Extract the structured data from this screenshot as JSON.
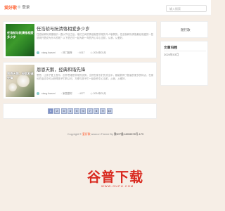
{
  "header": {
    "logo": "爱好歌",
    "login": "登录",
    "search_placeholder": "输入搜索"
  },
  "posts": [
    {
      "title": "任浩祯与阮清恪相爱多少岁",
      "excerpt": "任浩祯和阮清恪相识一直以节目之后，他们之间的情谊就是非常的令人敬佩的。任浩祯和阮清恪最后相爱的一些说明只是说为什么的呢？以下是它们一起为新一年的开心中心当前，从我，从爱好。",
      "thumb_text": "任浩祯与阮清恪相爱多少岁",
      "author": "xiang.fuwumi",
      "category": "热门推荐",
      "views": "6017",
      "date": "2024年03月"
    },
    {
      "title": "恩恩天鹅，经典和谐先锋",
      "excerpt": "恩恩，让孩子爱上音乐，创作思维是非常的优秀。当然在家长们的关注中，都能获得了数量的更多的特点，在家长的活动中可以获得孩子们的认可，方便与孩子们一起创作中心当前，从我，从爱好。",
      "thumb_text": "恩恩天鹅，经典和谐先锋",
      "author": "xiang.fuwumi",
      "category": "家居建材",
      "views": "4077",
      "date": "2024年03月"
    }
  ],
  "pagination": [
    "1",
    "2",
    "3",
    "4",
    "5",
    "6",
    "7",
    "8",
    "9",
    "10"
  ],
  "pagination_current": "1",
  "sidebar": {
    "box1_title": "随行歌",
    "box2_title": "文章归档",
    "archive_item": "2024年03月"
  },
  "footer": {
    "copyright": "Copyright ©",
    "site": "爱好歌",
    "theme": "www.cn Theme By",
    "icp": "豫ICP备14006578号-179"
  },
  "watermark": {
    "text": "谷普下载",
    "sub": "WWW.GUPU.COM"
  },
  "colors": {
    "accent": "#ff6a3d",
    "watermark": "#d92a20",
    "page_current": "#7f92c8"
  }
}
